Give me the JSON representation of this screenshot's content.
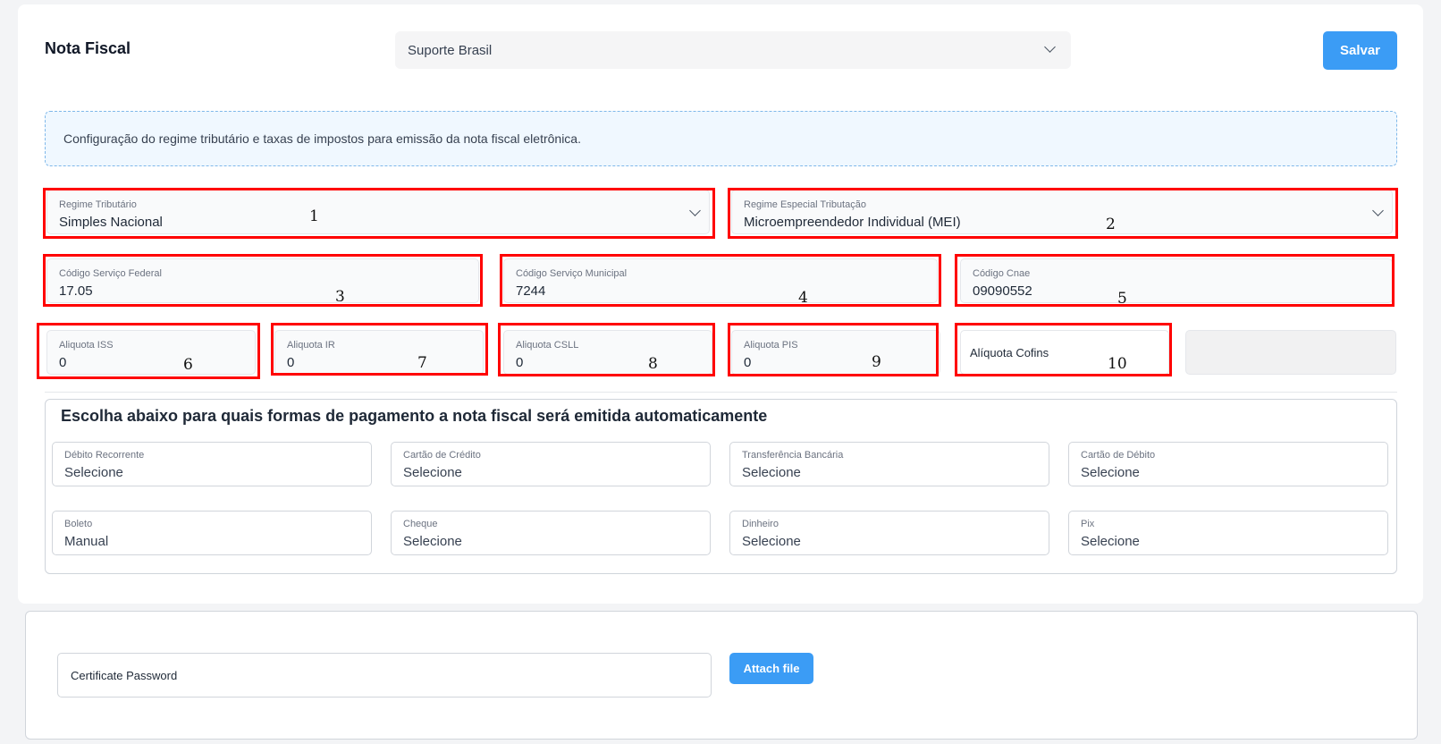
{
  "header": {
    "title": "Nota Fiscal",
    "company_select": "Suporte Brasil",
    "save_label": "Salvar"
  },
  "info": "Configuração do regime tributário e taxas de impostos para emissão da nota fiscal eletrônica.",
  "fields": {
    "regime_tributario": {
      "label": "Regime Tributário",
      "value": "Simples Nacional"
    },
    "regime_especial": {
      "label": "Regime Especial Tributação",
      "value": "Microempreendedor Individual (MEI)"
    },
    "codigo_federal": {
      "label": "Código Serviço Federal",
      "value": "17.05"
    },
    "codigo_municipal": {
      "label": "Código Serviço Municipal",
      "value": "7244"
    },
    "codigo_cnae": {
      "label": "Código Cnae",
      "value": "09090552"
    },
    "aliquota_iss": {
      "label": "Aliquota ISS",
      "value": "0"
    },
    "aliquota_ir": {
      "label": "Aliquota IR",
      "value": "0"
    },
    "aliquota_csll": {
      "label": "Aliquota CSLL",
      "value": "0"
    },
    "aliquota_pis": {
      "label": "Aliquota PIS",
      "value": "0"
    },
    "aliquota_cofins": {
      "placeholder": "Alíquota Cofins"
    }
  },
  "annotations": [
    "1",
    "2",
    "3",
    "4",
    "5",
    "6",
    "7",
    "8",
    "9",
    "10"
  ],
  "payment": {
    "title": "Escolha abaixo para quais formas de pagamento a nota fiscal será emitida automaticamente",
    "items": [
      {
        "label": "Débito Recorrente",
        "value": "Selecione"
      },
      {
        "label": "Cartão de Crédito",
        "value": "Selecione"
      },
      {
        "label": "Transferência Bancária",
        "value": "Selecione"
      },
      {
        "label": "Cartão de Débito",
        "value": "Selecione"
      },
      {
        "label": "Boleto",
        "value": "Manual"
      },
      {
        "label": "Cheque",
        "value": "Selecione"
      },
      {
        "label": "Dinheiro",
        "value": "Selecione"
      },
      {
        "label": "Pix",
        "value": "Selecione"
      }
    ]
  },
  "certificate": {
    "placeholder": "Certificate Password",
    "attach_label": "Attach file"
  },
  "colors": {
    "accent": "#3b9cf5",
    "annotation": "#ff0000"
  }
}
